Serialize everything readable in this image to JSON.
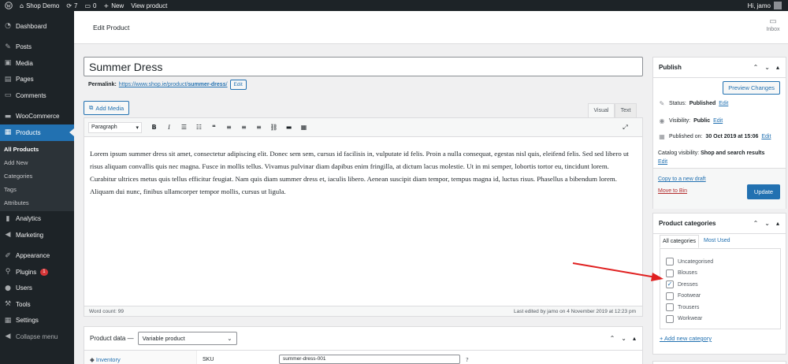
{
  "adminbar": {
    "site_name": "Shop Demo",
    "updates_count": "7",
    "comments_count": "0",
    "new_label": "New",
    "view_product": "View product",
    "greeting": "Hi, jamo"
  },
  "sidebar": {
    "dashboard": "Dashboard",
    "posts": "Posts",
    "media": "Media",
    "pages": "Pages",
    "comments": "Comments",
    "woocommerce": "WooCommerce",
    "products": "Products",
    "sub": [
      "All Products",
      "Add New",
      "Categories",
      "Tags",
      "Attributes"
    ],
    "analytics": "Analytics",
    "marketing": "Marketing",
    "appearance": "Appearance",
    "plugins": "Plugins",
    "plugins_badge": "1",
    "users": "Users",
    "tools": "Tools",
    "settings": "Settings",
    "collapse": "Collapse menu"
  },
  "header": {
    "title": "Edit Product",
    "inbox": "Inbox"
  },
  "editor": {
    "title_value": "Summer Dress",
    "permalink_label": "Permalink:",
    "permalink_base": "https://www.shop.ie/product/",
    "permalink_slug": "summer-dress",
    "permalink_end": "/",
    "edit_button": "Edit",
    "add_media": "Add Media",
    "tab_visual": "Visual",
    "tab_text": "Text",
    "format_select": "Paragraph",
    "content": "Lorem ipsum summer dress sit amet, consectetur adipiscing elit. Donec sem sem, cursus id facilisis in, vulputate id felis. Proin a nulla consequat, egestas nisl quis, eleifend felis. Sed sed libero ut risus aliquam convallis quis nec magna. Fusce in mollis tellus. Vivamus pulvinar diam dapibus enim fringilla, at dictum lacus molestie. Ut in mi semper, lobortis tortor eu, tincidunt lorem. Curabitur ultrices metus quis tellus efficitur feugiat. Nam quis diam summer dress et, iaculis libero. Aenean suscipit diam tempor, tempus magna id, luctus risus. Phasellus a bibendum lorem. Aliquam dui nunc, finibus ullamcorper tempor mollis, cursus ut ligula.",
    "word_count": "Word count: 99",
    "last_edited": "Last edited by jamo on 4 November 2019 at 12:23 pm"
  },
  "product_data": {
    "label": "Product data —",
    "type_select": "Variable product",
    "tab_inventory": "Inventory",
    "sku_label": "SKU",
    "sku_value": "summer-dress-001"
  },
  "publish": {
    "title": "Publish",
    "preview": "Preview Changes",
    "status_label": "Status:",
    "status_value": "Published",
    "visibility_label": "Visibility:",
    "visibility_value": "Public",
    "published_label": "Published on:",
    "published_value": "30 Oct 2019 at 15:06",
    "edit": "Edit",
    "catalog_label": "Catalog visibility:",
    "catalog_value": "Shop and search results",
    "copy_draft": "Copy to a new draft",
    "move_trash": "Move to Bin",
    "update": "Update"
  },
  "categories": {
    "title": "Product categories",
    "tab_all": "All categories",
    "tab_most": "Most Used",
    "items": [
      {
        "label": "Uncategorised",
        "checked": false
      },
      {
        "label": "Blouses",
        "checked": false
      },
      {
        "label": "Dresses",
        "checked": true
      },
      {
        "label": "Footwear",
        "checked": false
      },
      {
        "label": "Trousers",
        "checked": false
      },
      {
        "label": "Workwear",
        "checked": false
      }
    ],
    "add_new": "+ Add new category"
  },
  "colors": {
    "admin_dark": "#1d2327",
    "accent": "#2271b1",
    "arrow": "#e02020",
    "danger": "#b32d2e"
  }
}
